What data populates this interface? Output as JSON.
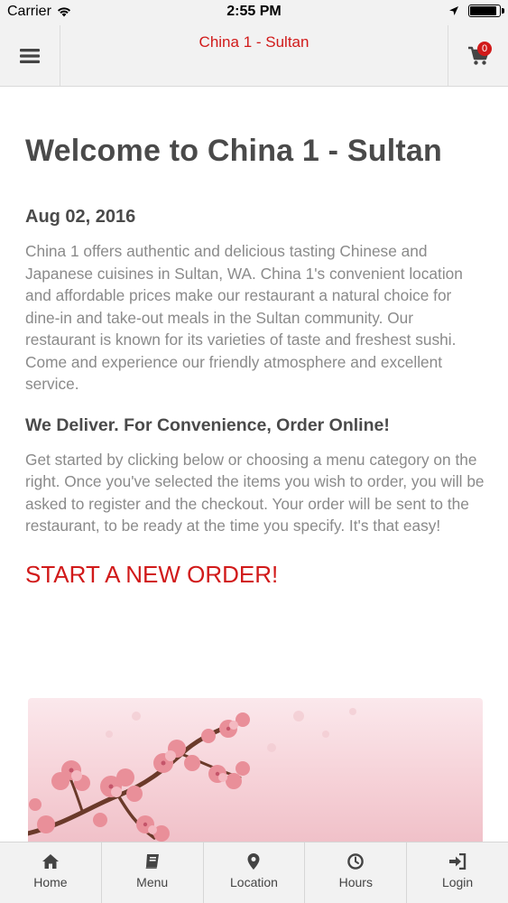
{
  "status_bar": {
    "carrier": "Carrier",
    "time": "2:55 PM",
    "battery_level": 0.95
  },
  "header": {
    "title": "China 1 - Sultan",
    "menu_icon": "hamburger-icon",
    "cart_icon": "cart-icon",
    "cart_count": "0"
  },
  "main": {
    "title": "Welcome to China 1 - Sultan",
    "date": "Aug 02, 2016",
    "intro": "China 1 offers authentic and delicious tasting Chinese and Japanese cuisines in Sultan, WA. China 1's convenient location and affordable prices make our restaurant a natural choice for dine-in and take-out meals in the Sultan community. Our restaurant is known for its varieties of taste and freshest sushi. Come and experience our friendly atmosphere and excellent service.",
    "subheading": "We Deliver. For Convenience, Order Online!",
    "instructions": "Get started by clicking below or choosing a menu category on the right. Once you've selected the items you wish to order, you will be asked to register and the checkout. Your order will be sent to the restaurant, to be ready at the time you specify. It's that easy!",
    "cta": "START A NEW ORDER!"
  },
  "colors": {
    "accent": "#d11a1a",
    "heading": "#4a4a4a",
    "body_text": "#8a8a8a",
    "bar_bg": "#f2f2f2"
  },
  "tabs": [
    {
      "label": "Home",
      "icon": "home-icon"
    },
    {
      "label": "Menu",
      "icon": "book-icon"
    },
    {
      "label": "Location",
      "icon": "map-pin-icon"
    },
    {
      "label": "Hours",
      "icon": "clock-icon"
    },
    {
      "label": "Login",
      "icon": "sign-in-icon"
    }
  ]
}
